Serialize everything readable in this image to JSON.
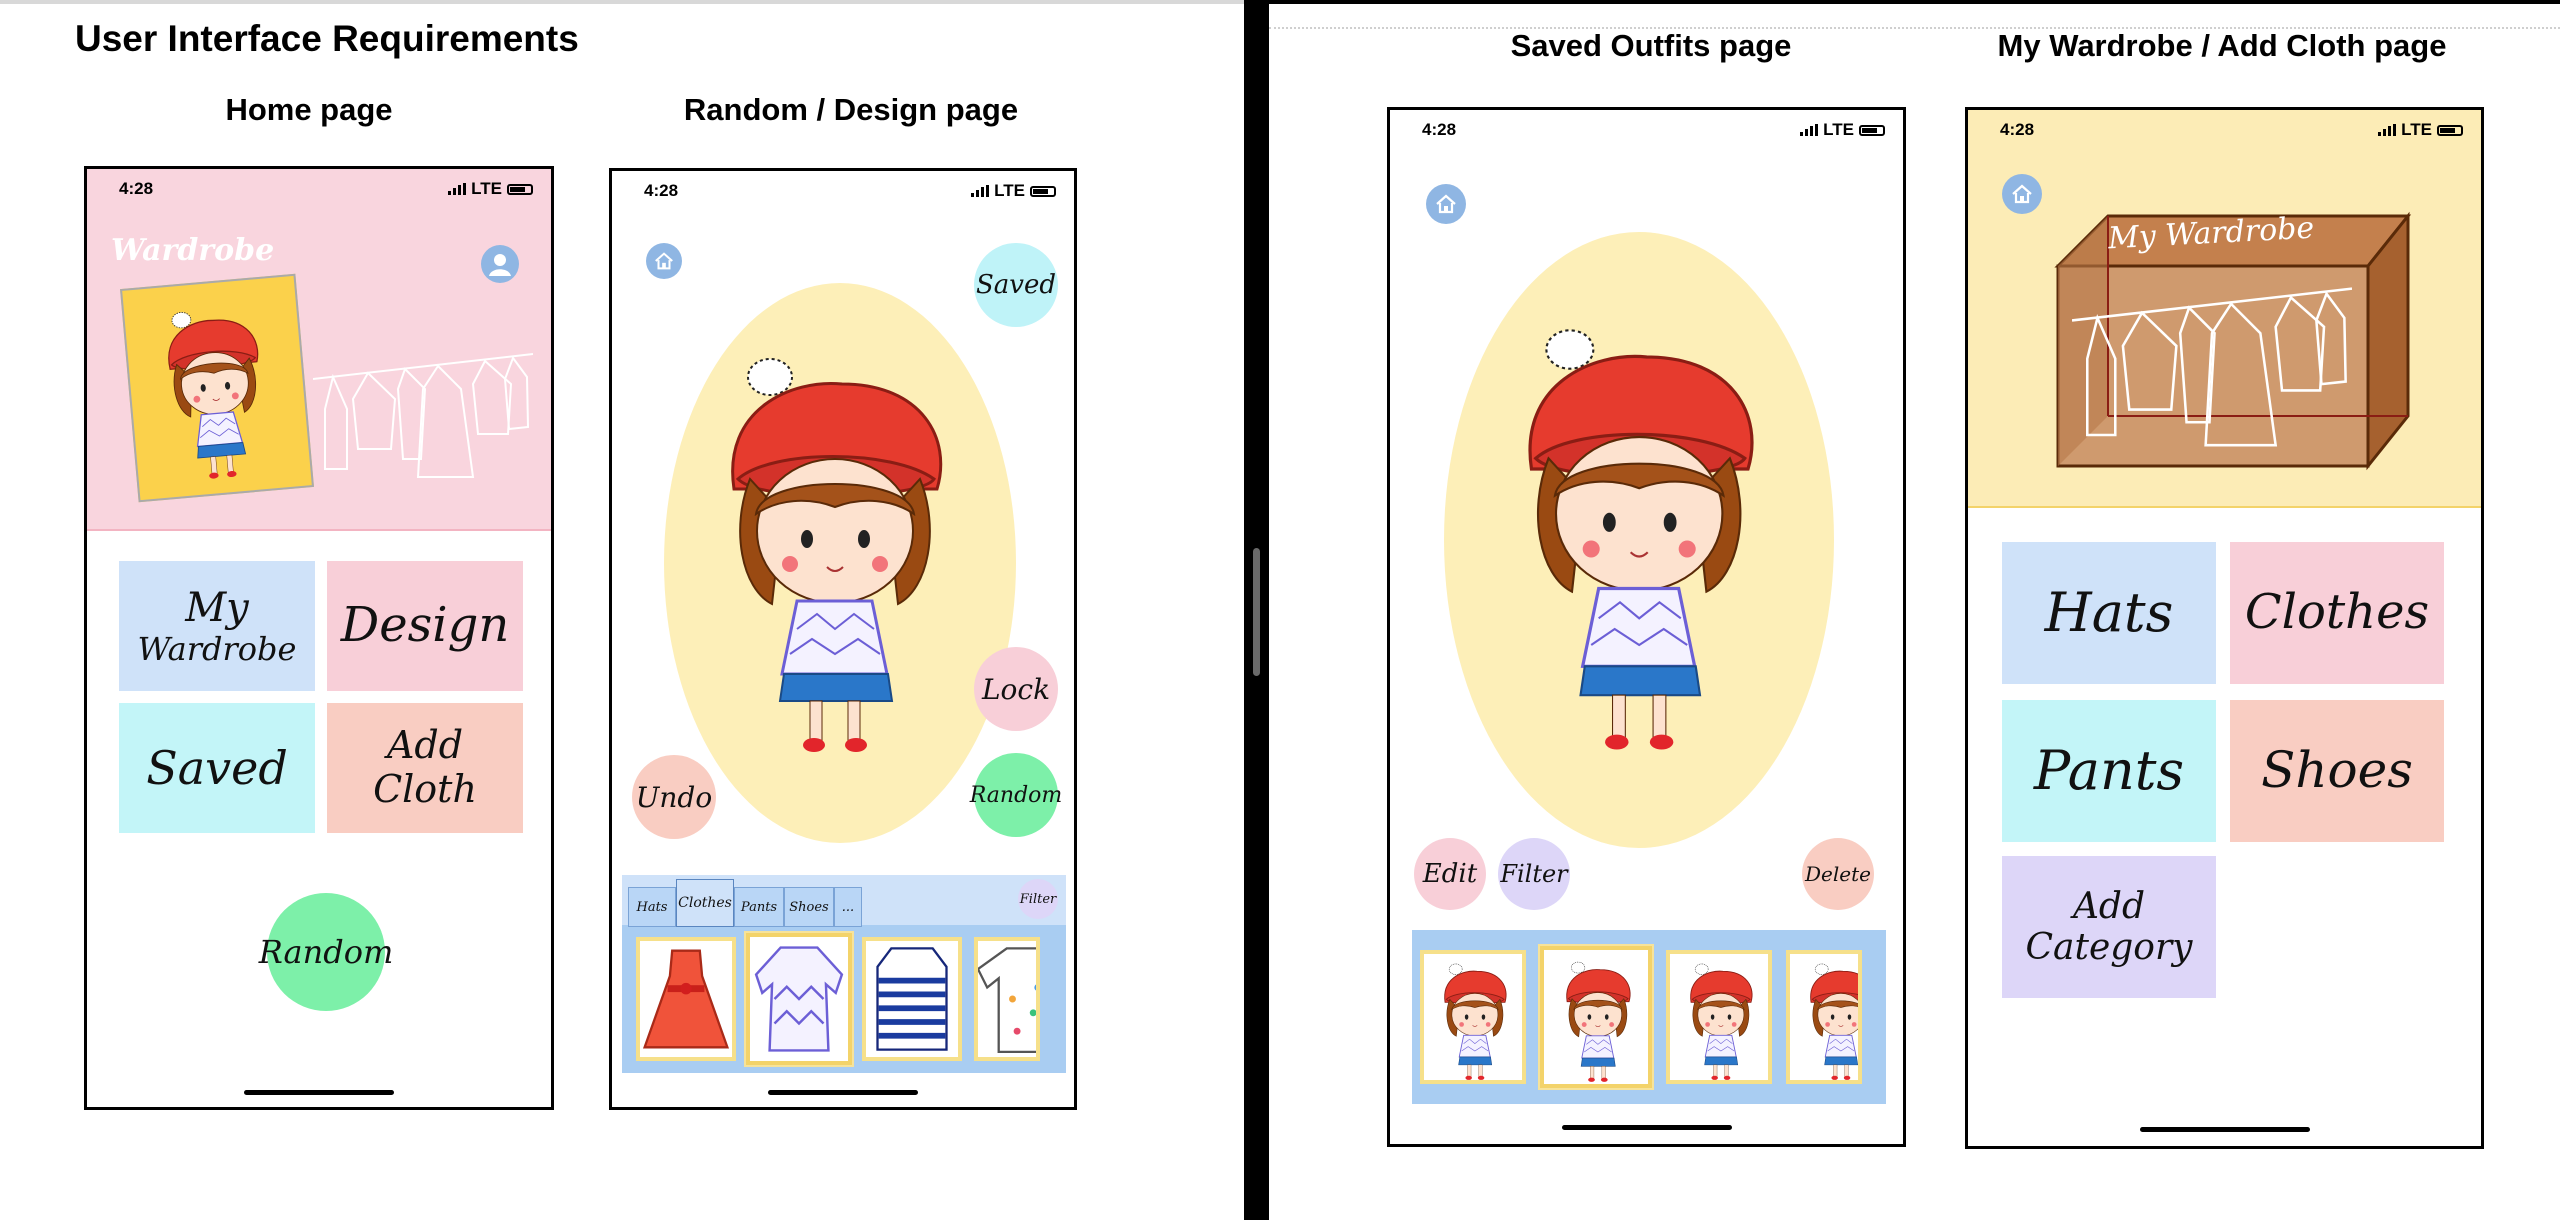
{
  "document": {
    "title": "User Interface Requirements"
  },
  "labels": {
    "home": "Home page",
    "design": "Random / Design page",
    "saved": "Saved Outfits page",
    "wardrobe": "My Wardrobe / Add Cloth page"
  },
  "status_bar": {
    "time": "4:28",
    "network": "LTE"
  },
  "home_page": {
    "header_title": "Wardrobe",
    "tiles": [
      {
        "line1": "My",
        "line2": "Wardrobe",
        "color": "#cfe2f9"
      },
      {
        "line1": "Design",
        "line2": "",
        "color": "#f8cfd8"
      },
      {
        "line1": "Saved",
        "line2": "",
        "color": "#c3f5f8"
      },
      {
        "line1": "Add",
        "line2": "Cloth",
        "color": "#f9cdc2"
      }
    ],
    "random_button": "Random",
    "header_color": "#f9d5de"
  },
  "design_page": {
    "saved_button": "Saved",
    "lock_button": "Lock",
    "undo_button": "Undo",
    "random_button": "Random",
    "tabs": [
      "Hats",
      "Clothes",
      "Pants",
      "Shoes",
      "..."
    ],
    "filter_button": "Filter"
  },
  "saved_page": {
    "edit_button": "Edit",
    "filter_button": "Filter",
    "delete_button": "Delete"
  },
  "wardrobe_page": {
    "sign": "My Wardrobe",
    "tiles": [
      {
        "line1": "Hats",
        "line2": "",
        "color": "#cfe2f9"
      },
      {
        "line1": "Clothes",
        "line2": "",
        "color": "#f8cfd8"
      },
      {
        "line1": "Pants",
        "line2": "",
        "color": "#c3f5f8"
      },
      {
        "line1": "Shoes",
        "line2": "",
        "color": "#f9cdc2"
      },
      {
        "line1": "Add",
        "line2": "Category",
        "color": "#ddd6f8"
      }
    ],
    "header_color": "#fcecb6"
  },
  "colors": {
    "oval": "#fdefb8",
    "saved_circle": "#bff3f8",
    "lock_circle": "#f8cfd8",
    "undo_circle": "#f9cdc2",
    "random_circle": "#7df0a9",
    "home_button": "#8fb6e3",
    "strip": "#a9cdf2",
    "edit_circle": "#f8cfd8",
    "filter_circle": "#ddd6f8",
    "delete_circle": "#f9cdc2"
  }
}
